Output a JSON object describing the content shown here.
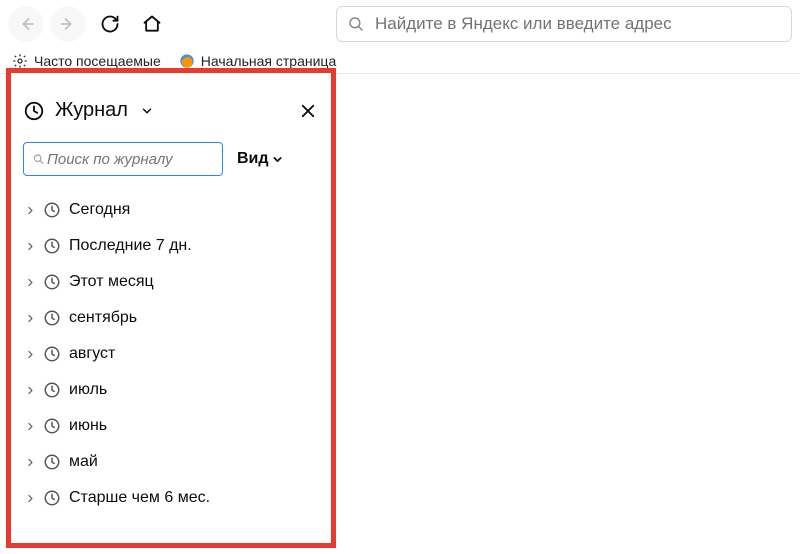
{
  "toolbar": {
    "urlbar_placeholder": "Найдите в Яндекс или введите адрес"
  },
  "bookmarks": {
    "frequent": "Часто посещаемые",
    "start_page": "Начальная страница"
  },
  "sidebar": {
    "title": "Журнал",
    "search_placeholder": "Поиск по журналу",
    "view_label": "Вид",
    "items": [
      {
        "label": "Сегодня"
      },
      {
        "label": "Последние 7 дн."
      },
      {
        "label": "Этот месяц"
      },
      {
        "label": "сентябрь"
      },
      {
        "label": "август"
      },
      {
        "label": "июль"
      },
      {
        "label": "июнь"
      },
      {
        "label": "май"
      },
      {
        "label": "Старше чем 6 мес."
      }
    ]
  }
}
